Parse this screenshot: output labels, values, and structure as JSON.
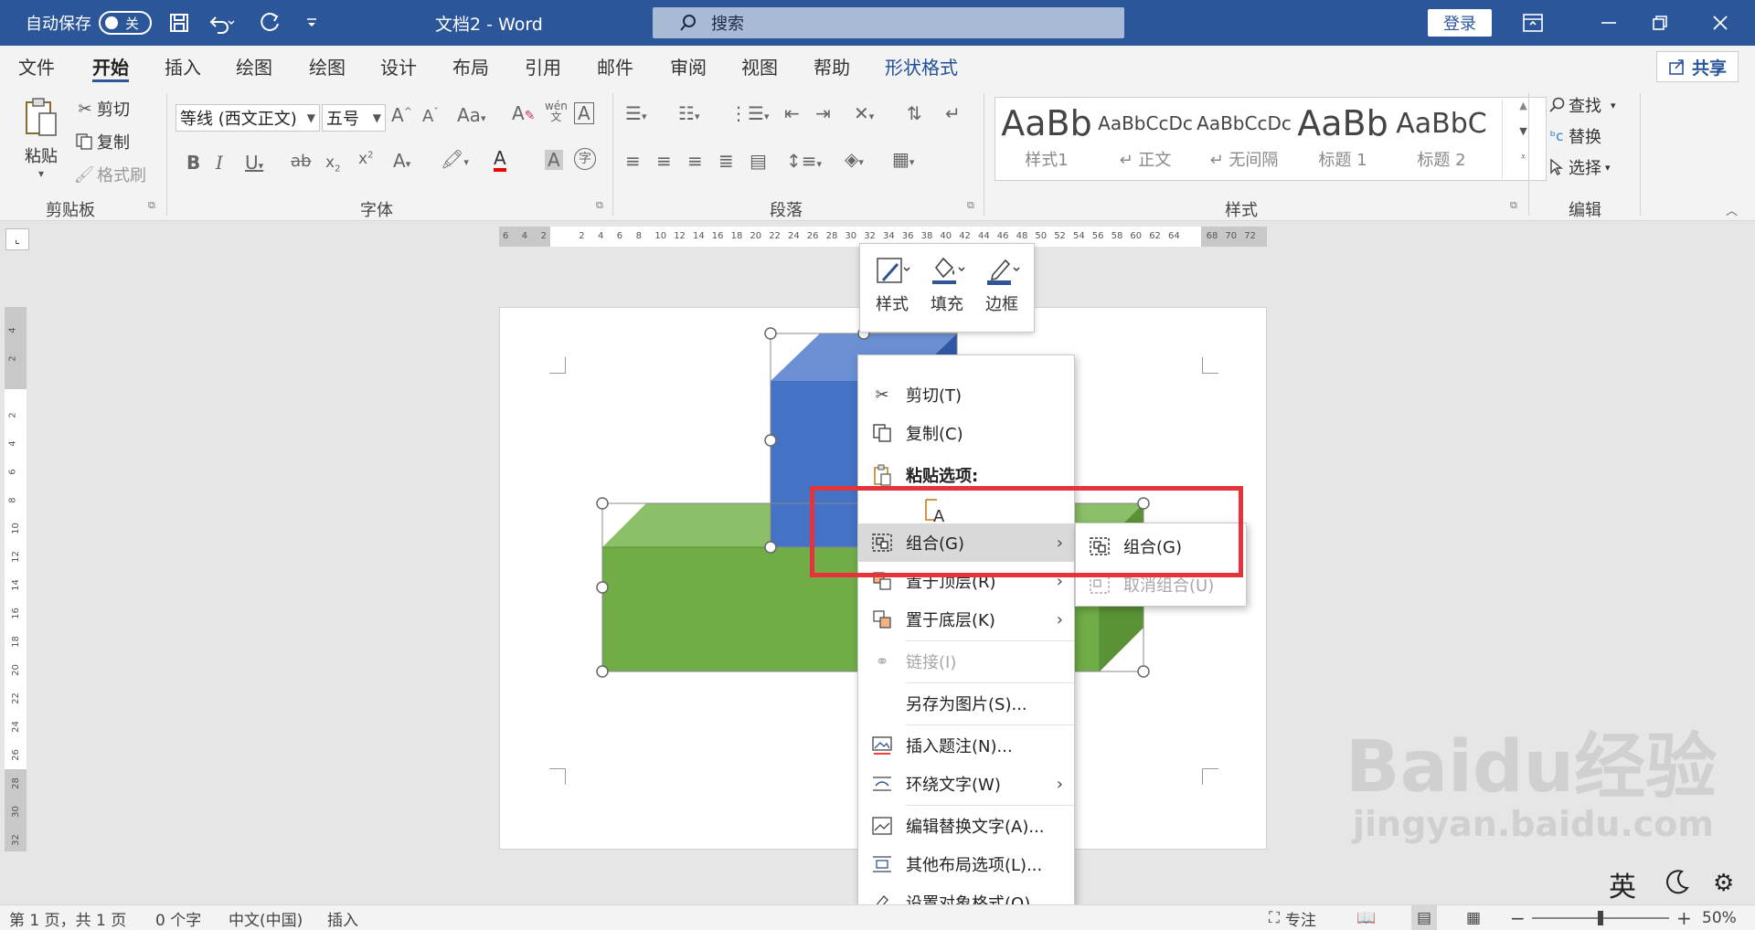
{
  "titlebar": {
    "autosave_label": "自动保存",
    "autosave_state": "关",
    "doc_title": "文档2 - Word",
    "search_placeholder": "搜索",
    "login": "登录"
  },
  "tabs": [
    "文件",
    "开始",
    "插入",
    "绘图",
    "绘图",
    "设计",
    "布局",
    "引用",
    "邮件",
    "审阅",
    "视图",
    "帮助",
    "形状格式"
  ],
  "share": "共享",
  "clipboard": {
    "paste": "粘贴",
    "cut": "剪切",
    "copy": "复制",
    "format_painter": "格式刷",
    "group_label": "剪贴板"
  },
  "font": {
    "name": "等线 (西文正文)",
    "size": "五号",
    "group_label": "字体",
    "phonetic": "wén"
  },
  "paragraph": {
    "group_label": "段落"
  },
  "styles": {
    "group_label": "样式",
    "items": [
      {
        "preview": "AaBb",
        "name": "样式1"
      },
      {
        "preview": "AaBbCcDc",
        "name": "↵ 正文"
      },
      {
        "preview": "AaBbCcDc",
        "name": "↵ 无间隔"
      },
      {
        "preview": "AaBb",
        "name": "标题 1"
      },
      {
        "preview": "AaBbC",
        "name": "标题 2"
      }
    ]
  },
  "editing": {
    "find": "查找",
    "replace": "替换",
    "select": "选择",
    "group_label": "编辑"
  },
  "ruler_numbers": [
    "6",
    "4",
    "2",
    "",
    "2",
    "4",
    "6",
    "8",
    "10",
    "12",
    "14",
    "16",
    "18",
    "20",
    "22",
    "24",
    "26",
    "28",
    "30",
    "32",
    "34",
    "36",
    "38",
    "40",
    "42",
    "44",
    "46",
    "48",
    "50",
    "52",
    "54",
    "56",
    "58",
    "60",
    "62",
    "64",
    "",
    "68",
    "70",
    "72"
  ],
  "vruler_numbers": [
    "4",
    "2",
    "",
    "2",
    "4",
    "6",
    "8",
    "10",
    "12",
    "14",
    "16",
    "18",
    "20",
    "22",
    "24",
    "26",
    "28",
    "30",
    "32"
  ],
  "mini_toolbar": {
    "style": "样式",
    "fill": "填充",
    "border": "边框"
  },
  "context_menu": {
    "cut": "剪切(T)",
    "copy": "复制(C)",
    "paste_options": "粘贴选项:",
    "group": "组合(G)",
    "bring_front": "置于顶层(R)",
    "send_back": "置于底层(K)",
    "link": "链接(I)",
    "save_picture": "另存为图片(S)...",
    "insert_caption": "插入题注(N)...",
    "wrap_text": "环绕文字(W)",
    "edit_alt": "编辑替换文字(A)...",
    "layout_options": "其他布局选项(L)...",
    "format_object": "设置对象格式(O)..."
  },
  "submenu": {
    "group": "组合(G)",
    "ungroup": "取消组合(U)"
  },
  "statusbar": {
    "page": "第 1 页，共 1 页",
    "words": "0 个字",
    "language": "中文(中国)",
    "mode": "插入",
    "focus": "专注",
    "zoom": "50%",
    "ime": "英"
  },
  "watermark": {
    "brand": "Baidu经验",
    "url": "jingyan.baidu.com"
  },
  "colors": {
    "title_bar": "#2b579a",
    "highlight": "#e5333b",
    "cube_blue": "#4472c4",
    "box_green": "#70ad47"
  }
}
